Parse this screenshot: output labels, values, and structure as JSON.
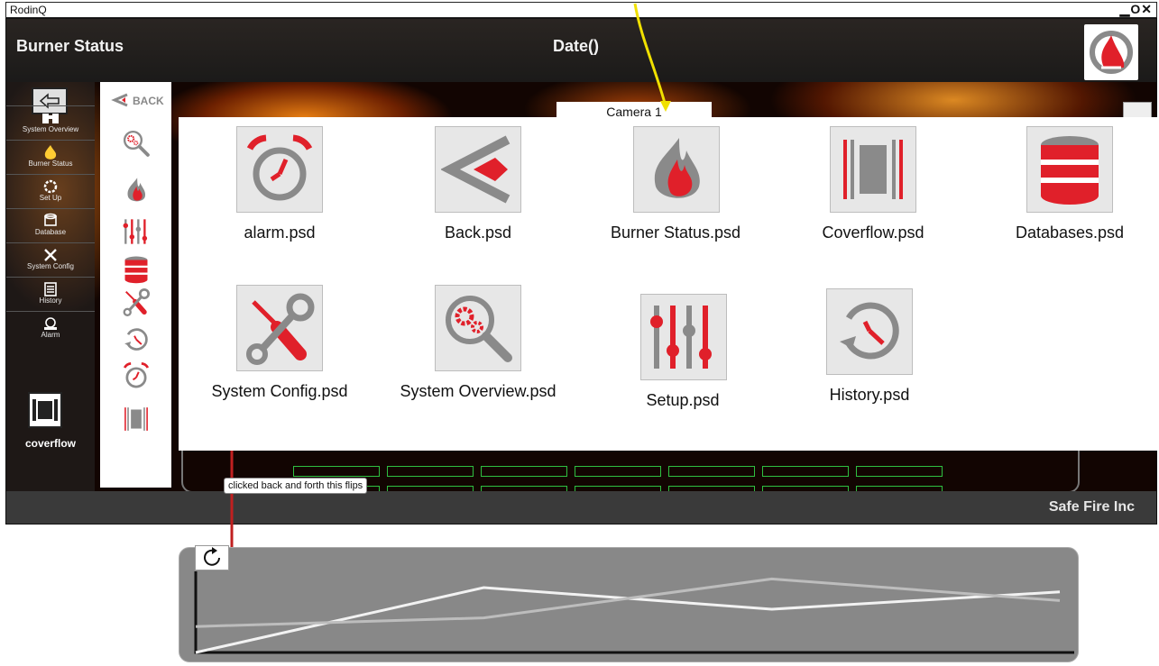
{
  "window": {
    "title": "RodinQ",
    "controls": "▁O✕"
  },
  "header": {
    "page_title": "Burner Status",
    "date_placeholder": "Date()"
  },
  "footer": {
    "company": "Safe Fire Inc"
  },
  "nav": {
    "items": [
      {
        "label": "System Overview",
        "icon": "binoculars-icon"
      },
      {
        "label": "Burner Status",
        "icon": "flame-icon"
      },
      {
        "label": "Set Up",
        "icon": "gear-icon"
      },
      {
        "label": "Database",
        "icon": "database-icon"
      },
      {
        "label": "System Config",
        "icon": "tools-icon"
      },
      {
        "label": "History",
        "icon": "list-icon"
      },
      {
        "label": "Alarm",
        "icon": "bell-icon"
      }
    ],
    "coverflow_label": "coverflow"
  },
  "strip": {
    "back_label": "BACK"
  },
  "camera_tab": {
    "label": "Camera 1"
  },
  "popup": {
    "items": [
      {
        "label": "alarm.psd",
        "icon": "alarm-clock-icon"
      },
      {
        "label": "Back.psd",
        "icon": "back-chevron-icon"
      },
      {
        "label": "Burner Status.psd",
        "icon": "flame-icon"
      },
      {
        "label": "Coverflow.psd",
        "icon": "coverflow-icon"
      },
      {
        "label": "Databases.psd",
        "icon": "database-icon"
      },
      {
        "label": "System Config.psd",
        "icon": "tools-icon"
      },
      {
        "label": "System Overview.psd",
        "icon": "magnifier-gears-icon"
      },
      {
        "label": "Setup.psd",
        "icon": "sliders-icon"
      },
      {
        "label": "History.psd",
        "icon": "history-icon"
      }
    ]
  },
  "annotation": {
    "text": "clicked back and forth this flips"
  },
  "colors": {
    "accent": "#e0202a",
    "icon_gray": "#8a8a8a",
    "grid_green": "#2fbf40",
    "chart_bg": "#888888"
  },
  "chart_data": {
    "type": "line",
    "x": [
      0,
      1,
      2,
      3
    ],
    "series": [
      {
        "values": [
          0.0,
          0.75,
          0.5,
          0.7
        ]
      },
      {
        "values": [
          0.3,
          0.4,
          0.85,
          0.6
        ]
      }
    ],
    "title": "",
    "xlabel": "",
    "ylabel": "",
    "ylim": [
      0,
      1
    ]
  }
}
